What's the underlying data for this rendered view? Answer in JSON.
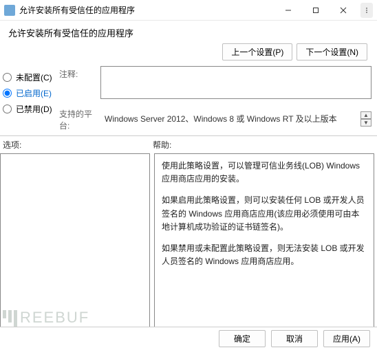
{
  "window": {
    "title": "允许安装所有受信任的应用程序",
    "subtitle": "允许安装所有受信任的应用程序"
  },
  "nav": {
    "prev": "上一个设置(P)",
    "next": "下一个设置(N)"
  },
  "radios": {
    "not_configured": "未配置(C)",
    "enabled": "已启用(E)",
    "disabled": "已禁用(D)",
    "selected": "enabled"
  },
  "labels": {
    "comment": "注释:",
    "platforms": "支持的平台:",
    "options": "选项:",
    "help": "帮助:"
  },
  "platforms_text": "Windows Server 2012、Windows 8 或 Windows RT 及以上版本",
  "help_paragraphs": [
    "使用此策略设置，可以管理可信业务线(LOB) Windows 应用商店应用的安装。",
    "如果启用此策略设置，则可以安装任何 LOB 或开发人员签名的 Windows 应用商店应用(该应用必须使用可由本地计算机成功验证的证书链签名)。",
    "如果禁用或未配置此策略设置，则无法安装 LOB 或开发人员签名的 Windows 应用商店应用。"
  ],
  "footer": {
    "ok": "确定",
    "cancel": "取消",
    "apply": "应用(A)"
  },
  "watermark": "REEBUF"
}
